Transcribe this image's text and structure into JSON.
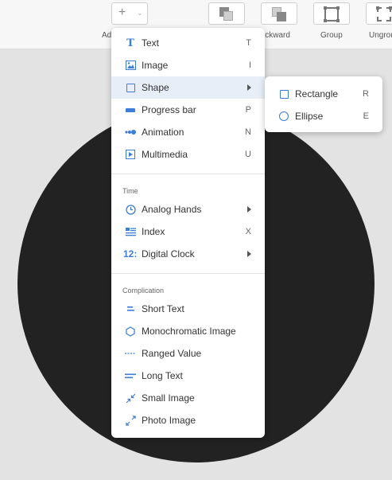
{
  "toolbar": {
    "add_label": "Add",
    "add_plus": "+",
    "add_chevron": "⌄",
    "backward_label": "Backward",
    "group_label": "Group",
    "ungroup_label": "Ungroup"
  },
  "menu": {
    "items": [
      {
        "label": "Text",
        "shortcut": "T",
        "icon": "text-icon"
      },
      {
        "label": "Image",
        "shortcut": "I",
        "icon": "image-icon"
      },
      {
        "label": "Shape",
        "shortcut": "",
        "icon": "shape-icon",
        "submenu": true,
        "highlighted": true
      },
      {
        "label": "Progress bar",
        "shortcut": "P",
        "icon": "progress-bar-icon"
      },
      {
        "label": "Animation",
        "shortcut": "N",
        "icon": "animation-icon"
      },
      {
        "label": "Multimedia",
        "shortcut": "U",
        "icon": "multimedia-icon"
      }
    ],
    "time_header": "Time",
    "time_items": [
      {
        "label": "Analog Hands",
        "icon": "clock-icon",
        "submenu": true
      },
      {
        "label": "Index",
        "shortcut": "X",
        "icon": "index-icon"
      },
      {
        "label": "Digital Clock",
        "icon": "digital-clock-icon",
        "icon_text": "12:",
        "submenu": true
      }
    ],
    "complication_header": "Complication",
    "complication_items": [
      {
        "label": "Short Text",
        "icon": "short-text-icon"
      },
      {
        "label": "Monochromatic Image",
        "icon": "hexagon-icon"
      },
      {
        "label": "Ranged Value",
        "icon": "ranged-value-icon"
      },
      {
        "label": "Long Text",
        "icon": "long-text-icon"
      },
      {
        "label": "Small Image",
        "icon": "small-image-icon"
      },
      {
        "label": "Photo Image",
        "icon": "photo-image-icon"
      }
    ]
  },
  "submenu": {
    "items": [
      {
        "label": "Rectangle",
        "shortcut": "R",
        "icon": "rectangle-icon"
      },
      {
        "label": "Ellipse",
        "shortcut": "E",
        "icon": "ellipse-icon"
      }
    ]
  },
  "colors": {
    "accent": "#3b7dd8",
    "canvas_circle": "#222222",
    "highlight": "#e8eef7"
  }
}
